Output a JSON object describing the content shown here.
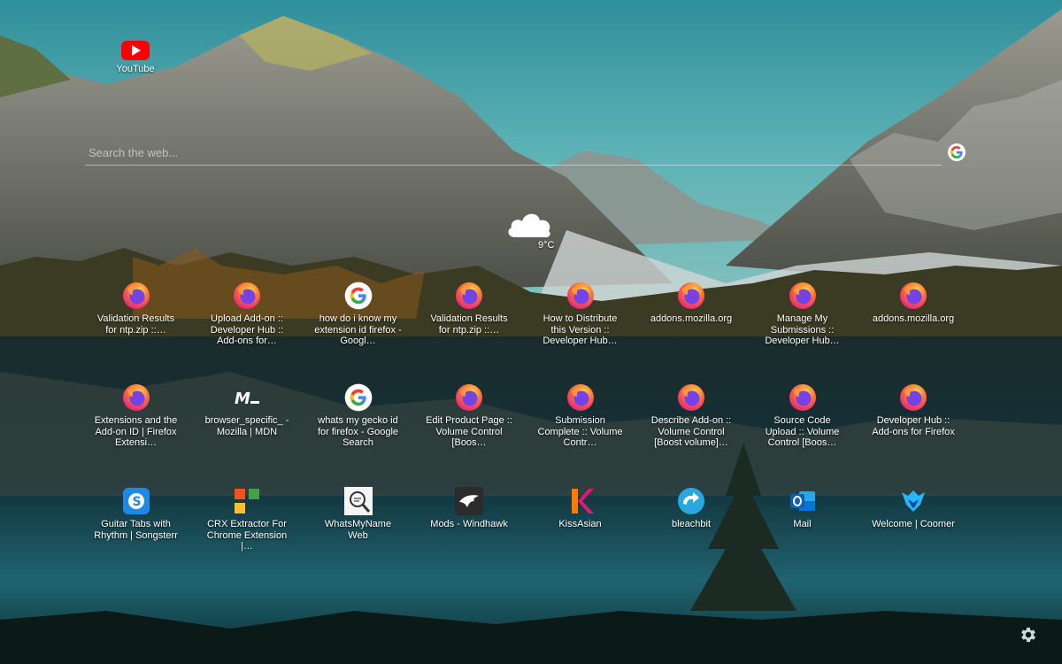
{
  "top_shortcut": {
    "label": "YouTube",
    "icon": "youtube-icon"
  },
  "search": {
    "placeholder": "Search the web...",
    "value": "",
    "engine_icon": "google-icon"
  },
  "weather": {
    "condition_icon": "cloud-icon",
    "temperature": "9°C"
  },
  "tiles": [
    {
      "label": "Validation Results for ntp.zip ::…",
      "icon": "firefox-icon"
    },
    {
      "label": "Upload Add-on :: Developer Hub :: Add-ons for…",
      "icon": "firefox-icon"
    },
    {
      "label": "how do i know my extension id firefox - Googl…",
      "icon": "google-icon"
    },
    {
      "label": "Validation Results for ntp.zip ::…",
      "icon": "firefox-icon"
    },
    {
      "label": "How to Distribute this Version :: Developer Hub…",
      "icon": "firefox-icon"
    },
    {
      "label": "addons.mozilla.org",
      "icon": "firefox-icon"
    },
    {
      "label": "Manage My Submissions :: Developer Hub…",
      "icon": "firefox-icon"
    },
    {
      "label": "addons.mozilla.org",
      "icon": "firefox-icon"
    },
    {
      "label": "Extensions and the Add-on ID | Firefox Extensi…",
      "icon": "firefox-icon"
    },
    {
      "label": "browser_specific_ - Mozilla | MDN",
      "icon": "mdn-icon"
    },
    {
      "label": "whats my gecko id for firefox - Google Search",
      "icon": "google-icon"
    },
    {
      "label": "Edit Product Page :: Volume Control [Boos…",
      "icon": "firefox-icon"
    },
    {
      "label": "Submission Complete :: Volume Contr…",
      "icon": "firefox-icon"
    },
    {
      "label": "Describe Add-on :: Volume Control [Boost volume]…",
      "icon": "firefox-icon"
    },
    {
      "label": "Source Code Upload :: Volume Control [Boos…",
      "icon": "firefox-icon"
    },
    {
      "label": "Developer Hub :: Add-ons for Firefox",
      "icon": "firefox-icon"
    },
    {
      "label": "Guitar Tabs with Rhythm | Songsterr",
      "icon": "songsterr-icon"
    },
    {
      "label": "CRX Extractor For Chrome Extension |…",
      "icon": "crx-extractor-icon"
    },
    {
      "label": "WhatsMyName Web",
      "icon": "whatsmyname-icon"
    },
    {
      "label": "Mods - Windhawk",
      "icon": "windhawk-icon"
    },
    {
      "label": "KissAsian",
      "icon": "kissasian-icon"
    },
    {
      "label": "bleachbit",
      "icon": "bleachbit-icon"
    },
    {
      "label": "Mail",
      "icon": "outlook-icon"
    },
    {
      "label": "Welcome | Coomer",
      "icon": "coomer-icon"
    }
  ],
  "settings": {
    "icon": "gear-icon"
  },
  "colors": {
    "sky": "#3f9fa8",
    "water": "#0f2d36",
    "accent_firefox": "#ff7139",
    "youtube": "#ff0000"
  }
}
